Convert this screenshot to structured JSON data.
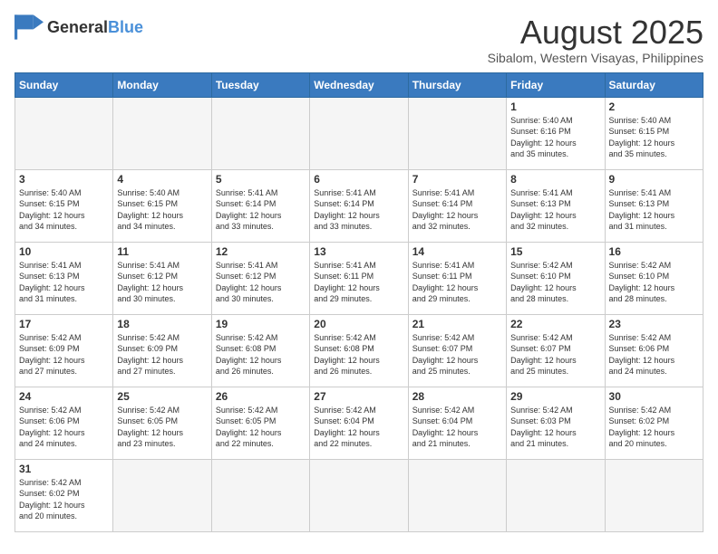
{
  "logo": {
    "text_general": "General",
    "text_blue": "Blue"
  },
  "title": {
    "month_year": "August 2025",
    "location": "Sibalom, Western Visayas, Philippines"
  },
  "weekdays": [
    "Sunday",
    "Monday",
    "Tuesday",
    "Wednesday",
    "Thursday",
    "Friday",
    "Saturday"
  ],
  "weeks": [
    [
      {
        "day": "",
        "info": ""
      },
      {
        "day": "",
        "info": ""
      },
      {
        "day": "",
        "info": ""
      },
      {
        "day": "",
        "info": ""
      },
      {
        "day": "",
        "info": ""
      },
      {
        "day": "1",
        "info": "Sunrise: 5:40 AM\nSunset: 6:16 PM\nDaylight: 12 hours\nand 35 minutes."
      },
      {
        "day": "2",
        "info": "Sunrise: 5:40 AM\nSunset: 6:15 PM\nDaylight: 12 hours\nand 35 minutes."
      }
    ],
    [
      {
        "day": "3",
        "info": "Sunrise: 5:40 AM\nSunset: 6:15 PM\nDaylight: 12 hours\nand 34 minutes."
      },
      {
        "day": "4",
        "info": "Sunrise: 5:40 AM\nSunset: 6:15 PM\nDaylight: 12 hours\nand 34 minutes."
      },
      {
        "day": "5",
        "info": "Sunrise: 5:41 AM\nSunset: 6:14 PM\nDaylight: 12 hours\nand 33 minutes."
      },
      {
        "day": "6",
        "info": "Sunrise: 5:41 AM\nSunset: 6:14 PM\nDaylight: 12 hours\nand 33 minutes."
      },
      {
        "day": "7",
        "info": "Sunrise: 5:41 AM\nSunset: 6:14 PM\nDaylight: 12 hours\nand 32 minutes."
      },
      {
        "day": "8",
        "info": "Sunrise: 5:41 AM\nSunset: 6:13 PM\nDaylight: 12 hours\nand 32 minutes."
      },
      {
        "day": "9",
        "info": "Sunrise: 5:41 AM\nSunset: 6:13 PM\nDaylight: 12 hours\nand 31 minutes."
      }
    ],
    [
      {
        "day": "10",
        "info": "Sunrise: 5:41 AM\nSunset: 6:13 PM\nDaylight: 12 hours\nand 31 minutes."
      },
      {
        "day": "11",
        "info": "Sunrise: 5:41 AM\nSunset: 6:12 PM\nDaylight: 12 hours\nand 30 minutes."
      },
      {
        "day": "12",
        "info": "Sunrise: 5:41 AM\nSunset: 6:12 PM\nDaylight: 12 hours\nand 30 minutes."
      },
      {
        "day": "13",
        "info": "Sunrise: 5:41 AM\nSunset: 6:11 PM\nDaylight: 12 hours\nand 29 minutes."
      },
      {
        "day": "14",
        "info": "Sunrise: 5:41 AM\nSunset: 6:11 PM\nDaylight: 12 hours\nand 29 minutes."
      },
      {
        "day": "15",
        "info": "Sunrise: 5:42 AM\nSunset: 6:10 PM\nDaylight: 12 hours\nand 28 minutes."
      },
      {
        "day": "16",
        "info": "Sunrise: 5:42 AM\nSunset: 6:10 PM\nDaylight: 12 hours\nand 28 minutes."
      }
    ],
    [
      {
        "day": "17",
        "info": "Sunrise: 5:42 AM\nSunset: 6:09 PM\nDaylight: 12 hours\nand 27 minutes."
      },
      {
        "day": "18",
        "info": "Sunrise: 5:42 AM\nSunset: 6:09 PM\nDaylight: 12 hours\nand 27 minutes."
      },
      {
        "day": "19",
        "info": "Sunrise: 5:42 AM\nSunset: 6:08 PM\nDaylight: 12 hours\nand 26 minutes."
      },
      {
        "day": "20",
        "info": "Sunrise: 5:42 AM\nSunset: 6:08 PM\nDaylight: 12 hours\nand 26 minutes."
      },
      {
        "day": "21",
        "info": "Sunrise: 5:42 AM\nSunset: 6:07 PM\nDaylight: 12 hours\nand 25 minutes."
      },
      {
        "day": "22",
        "info": "Sunrise: 5:42 AM\nSunset: 6:07 PM\nDaylight: 12 hours\nand 25 minutes."
      },
      {
        "day": "23",
        "info": "Sunrise: 5:42 AM\nSunset: 6:06 PM\nDaylight: 12 hours\nand 24 minutes."
      }
    ],
    [
      {
        "day": "24",
        "info": "Sunrise: 5:42 AM\nSunset: 6:06 PM\nDaylight: 12 hours\nand 24 minutes."
      },
      {
        "day": "25",
        "info": "Sunrise: 5:42 AM\nSunset: 6:05 PM\nDaylight: 12 hours\nand 23 minutes."
      },
      {
        "day": "26",
        "info": "Sunrise: 5:42 AM\nSunset: 6:05 PM\nDaylight: 12 hours\nand 22 minutes."
      },
      {
        "day": "27",
        "info": "Sunrise: 5:42 AM\nSunset: 6:04 PM\nDaylight: 12 hours\nand 22 minutes."
      },
      {
        "day": "28",
        "info": "Sunrise: 5:42 AM\nSunset: 6:04 PM\nDaylight: 12 hours\nand 21 minutes."
      },
      {
        "day": "29",
        "info": "Sunrise: 5:42 AM\nSunset: 6:03 PM\nDaylight: 12 hours\nand 21 minutes."
      },
      {
        "day": "30",
        "info": "Sunrise: 5:42 AM\nSunset: 6:02 PM\nDaylight: 12 hours\nand 20 minutes."
      }
    ],
    [
      {
        "day": "31",
        "info": "Sunrise: 5:42 AM\nSunset: 6:02 PM\nDaylight: 12 hours\nand 20 minutes."
      },
      {
        "day": "",
        "info": ""
      },
      {
        "day": "",
        "info": ""
      },
      {
        "day": "",
        "info": ""
      },
      {
        "day": "",
        "info": ""
      },
      {
        "day": "",
        "info": ""
      },
      {
        "day": "",
        "info": ""
      }
    ]
  ]
}
